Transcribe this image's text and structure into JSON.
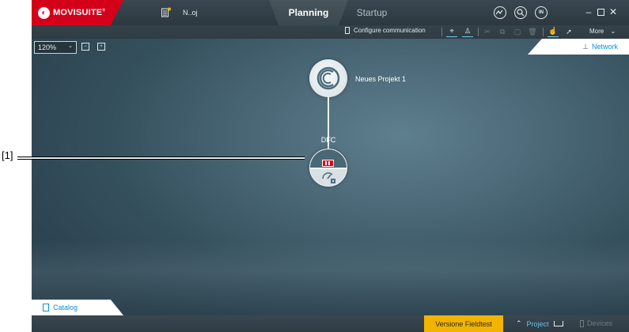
{
  "app": {
    "name": "MOVISUITE",
    "trademark": "®",
    "project_name": "N..oj"
  },
  "tabs": [
    {
      "label": "Planning",
      "active": true
    },
    {
      "label": "Startup",
      "active": false
    }
  ],
  "header_buttons": {
    "online": "IN"
  },
  "toolbar": {
    "configure_label": "Configure communication",
    "more_label": "More"
  },
  "canvas": {
    "zoom": "120%",
    "network_tab": "Network",
    "catalog_tab": "Catalog",
    "project_node_label": "Neues Projekt 1",
    "device_node_label": "DFC"
  },
  "statusbar": {
    "version": "Versione Fieldtest",
    "project": "Project",
    "devices": "Devices"
  },
  "callout": {
    "label": "[1]"
  },
  "colors": {
    "brand_red": "#d4001a",
    "accent_blue": "#0c8fd2",
    "badge_yellow": "#f2b400"
  }
}
